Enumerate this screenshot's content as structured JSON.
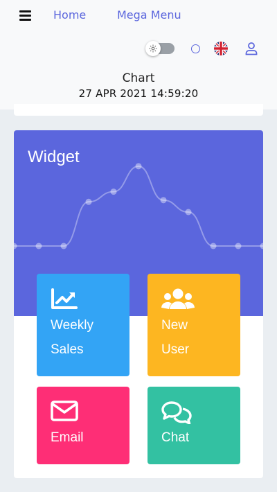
{
  "nav": {
    "home_label": "Home",
    "mega_label": "Mega Menu"
  },
  "toolbar": {
    "toggle_icon": "gear-icon",
    "flag_icon": "uk-flag-icon",
    "user_icon": "user-icon"
  },
  "header": {
    "title": "Chart",
    "datetime": "27 APR 2021 14:59:20"
  },
  "widget": {
    "title": "Widget",
    "banner_color": "#5b66dd",
    "sparkline": [
      0,
      0,
      0,
      26,
      32,
      47,
      27,
      20,
      0,
      0,
      0
    ],
    "tiles": [
      {
        "line1": "Weekly",
        "line2": "Sales",
        "icon": "chart-line-icon",
        "color": "#33a4f5"
      },
      {
        "line1": "New",
        "line2": "User",
        "icon": "users-icon",
        "color": "#fdb621"
      },
      {
        "label": "Email",
        "icon": "envelope-icon",
        "color": "#fe2e76"
      },
      {
        "label": "Chat",
        "icon": "chat-bubbles-icon",
        "color": "#33c1a2"
      }
    ]
  }
}
